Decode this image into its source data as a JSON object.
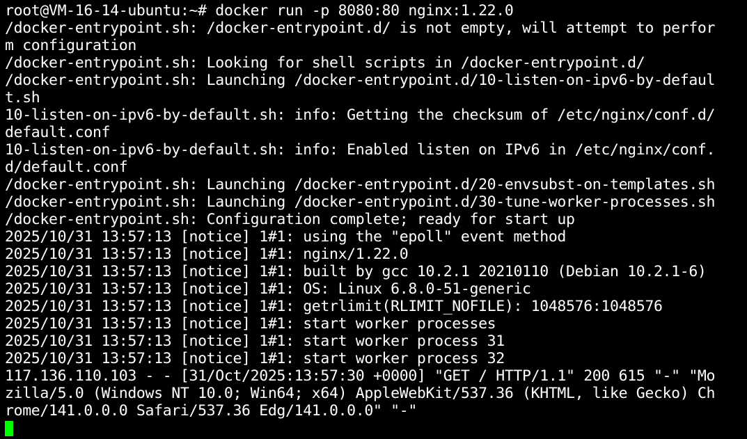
{
  "terminal": {
    "colors": {
      "background": "#000000",
      "text": "#FFFFFF",
      "cursor": "#00FF00"
    },
    "lines": [
      "root@VM-16-14-ubuntu:~# docker run -p 8080:80 nginx:1.22.0",
      "/docker-entrypoint.sh: /docker-entrypoint.d/ is not empty, will attempt to perfor",
      "m configuration",
      "/docker-entrypoint.sh: Looking for shell scripts in /docker-entrypoint.d/",
      "/docker-entrypoint.sh: Launching /docker-entrypoint.d/10-listen-on-ipv6-by-defaul",
      "t.sh",
      "10-listen-on-ipv6-by-default.sh: info: Getting the checksum of /etc/nginx/conf.d/",
      "default.conf",
      "10-listen-on-ipv6-by-default.sh: info: Enabled listen on IPv6 in /etc/nginx/conf.",
      "d/default.conf",
      "/docker-entrypoint.sh: Launching /docker-entrypoint.d/20-envsubst-on-templates.sh",
      "/docker-entrypoint.sh: Launching /docker-entrypoint.d/30-tune-worker-processes.sh",
      "/docker-entrypoint.sh: Configuration complete; ready for start up",
      "2025/10/31 13:57:13 [notice] 1#1: using the \"epoll\" event method",
      "2025/10/31 13:57:13 [notice] 1#1: nginx/1.22.0",
      "2025/10/31 13:57:13 [notice] 1#1: built by gcc 10.2.1 20210110 (Debian 10.2.1-6)",
      "2025/10/31 13:57:13 [notice] 1#1: OS: Linux 6.8.0-51-generic",
      "2025/10/31 13:57:13 [notice] 1#1: getrlimit(RLIMIT_NOFILE): 1048576:1048576",
      "2025/10/31 13:57:13 [notice] 1#1: start worker processes",
      "2025/10/31 13:57:13 [notice] 1#1: start worker process 31",
      "2025/10/31 13:57:13 [notice] 1#1: start worker process 32",
      "117.136.110.103 - - [31/Oct/2025:13:57:30 +0000] \"GET / HTTP/1.1\" 200 615 \"-\" \"Mo",
      "zilla/5.0 (Windows NT 10.0; Win64; x64) AppleWebKit/537.36 (KHTML, like Gecko) Ch",
      "rome/141.0.0.0 Safari/537.36 Edg/141.0.0.0\" \"-\""
    ]
  }
}
